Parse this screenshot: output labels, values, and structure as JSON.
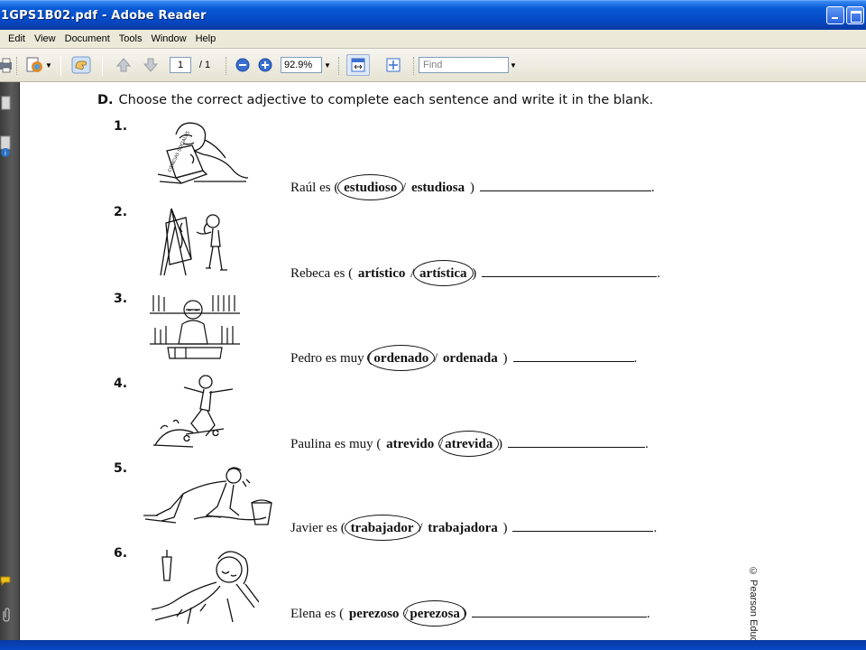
{
  "window": {
    "title": "1GPS1B02.pdf - Adobe Reader"
  },
  "menu": [
    "Edit",
    "View",
    "Document",
    "Tools",
    "Window",
    "Help"
  ],
  "toolbar": {
    "page_current": "1",
    "page_total": "/ 1",
    "zoom": "92.9%",
    "find_placeholder": "Find"
  },
  "document": {
    "instruction_letter": "D.",
    "instruction_text": "Choose the correct adjective to complete each sentence and write it in the blank.",
    "items": [
      {
        "num": "1.",
        "prefix": "Raúl es (",
        "opt1": "estudioso",
        "sep": "/",
        "opt2": "estudiosa",
        "suffix": ")",
        "circled": 1,
        "end": "."
      },
      {
        "num": "2.",
        "prefix": "Rebeca es (",
        "opt1": "artístico",
        "sep": "/",
        "opt2": "artística",
        "suffix": ")",
        "circled": 2,
        "end": "."
      },
      {
        "num": "3.",
        "prefix": "Pedro es muy (",
        "opt1": "ordenado",
        "sep": "/",
        "opt2": "ordenada",
        "suffix": ")",
        "circled": 1,
        "end": "."
      },
      {
        "num": "4.",
        "prefix": "Paulina es muy (",
        "opt1": "atrevido",
        "sep": "/",
        "opt2": "atrevida",
        "suffix": ")",
        "circled": 2,
        "end": "."
      },
      {
        "num": "5.",
        "prefix": "Javier es (",
        "opt1": "trabajador",
        "sep": "/",
        "opt2": "trabajadora",
        "suffix": ")",
        "circled": 1,
        "end": "."
      },
      {
        "num": "6.",
        "prefix": "Elena es (",
        "opt1": "perezoso",
        "sep": "/",
        "opt2": "perezosa",
        "suffix": ")",
        "circled": 2,
        "end": "."
      }
    ],
    "book_cover_text": "CIENCIAS SOCIALES",
    "copyright": "© Pearson Educatio"
  }
}
